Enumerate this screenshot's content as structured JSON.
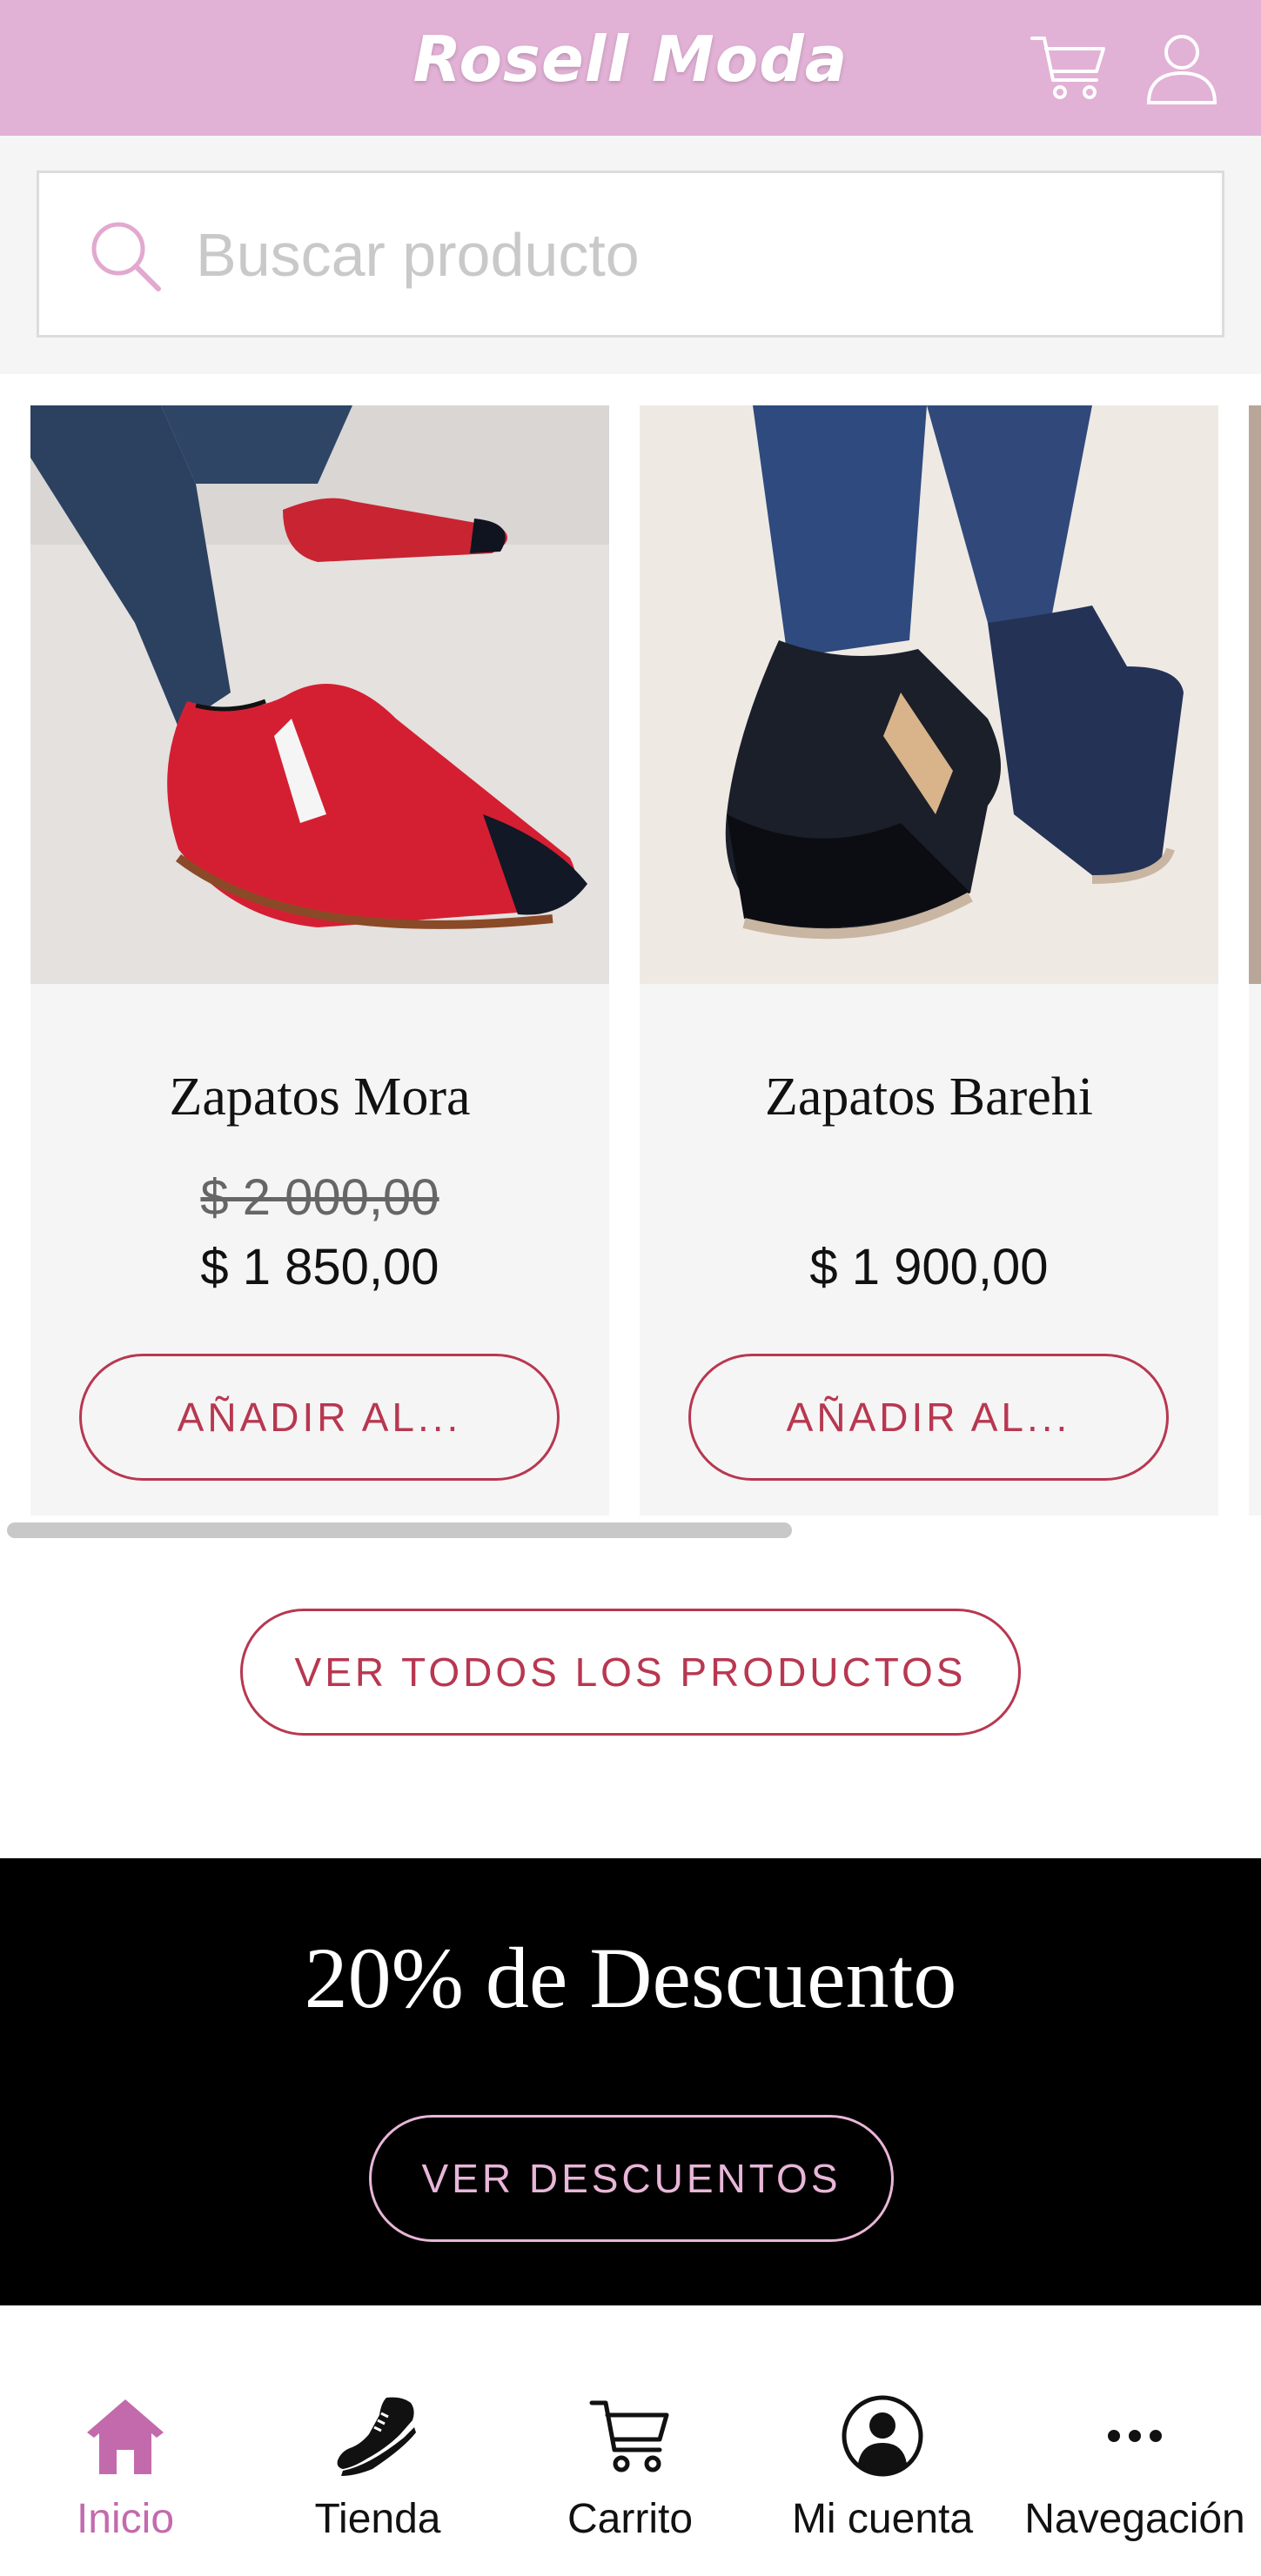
{
  "header": {
    "brand": "Rosell Moda",
    "cart_icon": "cart-icon",
    "user_icon": "user-icon",
    "bg_color": "#e2b1d6"
  },
  "search": {
    "placeholder": "Buscar producto",
    "icon": "search-icon"
  },
  "products": [
    {
      "name": "Zapatos Mora",
      "price_old": "$ 2 000,00",
      "price": "$ 1 850,00",
      "button": "AÑADIR AL..."
    },
    {
      "name": "Zapatos Barehi",
      "price_old": "",
      "price": "$ 1 900,00",
      "button": "AÑADIR AL..."
    }
  ],
  "view_all_button": "VER TODOS LOS PRODUCTOS",
  "promo": {
    "title": "20% de Descuento",
    "button": "VER DESCUENTOS"
  },
  "bottom_nav": [
    {
      "label": "Inicio",
      "icon": "home-icon",
      "active": true
    },
    {
      "label": "Tienda",
      "icon": "sneaker-icon",
      "active": false
    },
    {
      "label": "Carrito",
      "icon": "cart-icon",
      "active": false
    },
    {
      "label": "Mi cuenta",
      "icon": "account-icon",
      "active": false
    },
    {
      "label": "Navegación",
      "icon": "more-icon",
      "active": false
    }
  ],
  "colors": {
    "accent": "#b83750",
    "nav_active": "#c36aad",
    "promo_bg": "#000000",
    "promo_accent": "#e8b6d8"
  }
}
